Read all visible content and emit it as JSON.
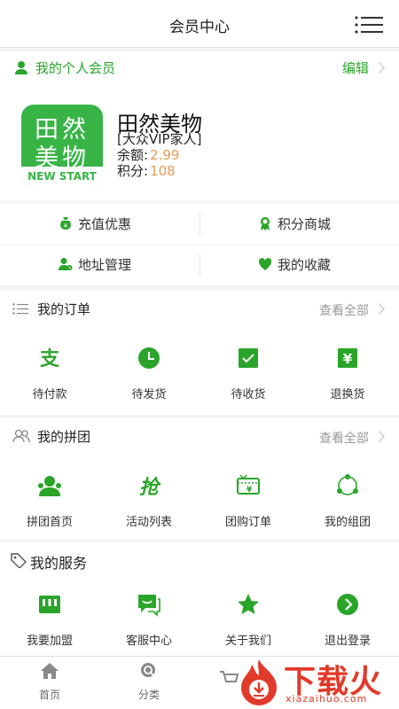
{
  "header": {
    "title": "会员中心"
  },
  "member": {
    "label": "我的个人会员",
    "edit": "编辑"
  },
  "profile": {
    "logo_line1": "田然",
    "logo_line2": "美物",
    "logo_sub": "NEW START",
    "name": "田然美物",
    "level": "[大众VIP家人]",
    "balance_label": "余额:",
    "balance_value": "2.99",
    "points_label": "积分:",
    "points_value": "108"
  },
  "quick": [
    {
      "label": "充值优惠",
      "icon": "money-bag-icon"
    },
    {
      "label": "积分商城",
      "icon": "medal-icon"
    },
    {
      "label": "地址管理",
      "icon": "user-location-icon"
    },
    {
      "label": "我的收藏",
      "icon": "heart-icon"
    }
  ],
  "orders": {
    "title": "我的订单",
    "more": "查看全部",
    "items": [
      {
        "label": "待付款",
        "icon": "alipay-icon"
      },
      {
        "label": "待发货",
        "icon": "clock-icon"
      },
      {
        "label": "待收货",
        "icon": "checkbox-icon"
      },
      {
        "label": "退换货",
        "icon": "yuan-icon"
      }
    ]
  },
  "group": {
    "title": "我的拼团",
    "more": "查看全部",
    "items": [
      {
        "label": "拼团首页",
        "icon": "group-users-icon"
      },
      {
        "label": "活动列表",
        "icon": "grab-icon"
      },
      {
        "label": "团购订单",
        "icon": "ticket-icon"
      },
      {
        "label": "我的组团",
        "icon": "share-nodes-icon"
      }
    ]
  },
  "services": {
    "title": "我的服务",
    "items": [
      {
        "label": "我要加盟",
        "icon": "store-icon"
      },
      {
        "label": "客服中心",
        "icon": "chat-icon"
      },
      {
        "label": "关于我们",
        "icon": "star-icon"
      },
      {
        "label": "退出登录",
        "icon": "arrow-right-circle-icon"
      }
    ]
  },
  "nav": [
    {
      "label": "首页",
      "icon": "home-icon"
    },
    {
      "label": "分类",
      "icon": "search-category-icon"
    }
  ],
  "watermark": {
    "text": "下载火",
    "url": "xiazaihuo.com"
  },
  "colors": {
    "accent": "#2aa52a",
    "value": "#e39a56",
    "watermark": "#e23a2a"
  }
}
